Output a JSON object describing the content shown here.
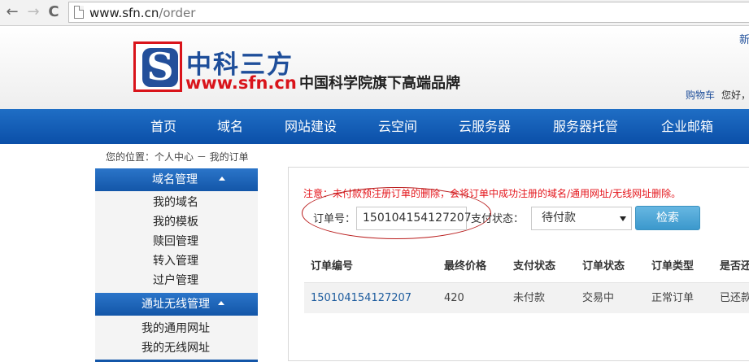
{
  "browser": {
    "back_glyph": "←",
    "forward_glyph": "→",
    "reload_glyph": "C",
    "url_host": "www.sfn.cn",
    "url_path": "/order"
  },
  "header": {
    "logo_letter": "S",
    "brand_cn": "中科三方",
    "brand_url": "www.sfn.cn",
    "slogan": "中国科学院旗下高端品牌",
    "top_right": "新",
    "cart": "购物车",
    "hello": "您好，"
  },
  "nav": {
    "items": [
      "首页",
      "域名",
      "网站建设",
      "云空间",
      "云服务器",
      "服务器托管",
      "企业邮箱"
    ]
  },
  "breadcrumb": "您的位置：个人中心 － 我的订单",
  "sidebar": {
    "sections": [
      {
        "title": "域名管理",
        "links": [
          "我的域名",
          "我的模板",
          "赎回管理",
          "转入管理",
          "过户管理"
        ]
      },
      {
        "title": "通址无线管理",
        "links": [
          "我的通用网址",
          "我的无线网址"
        ]
      }
    ]
  },
  "content": {
    "notice": "注意：未付款预注册订单的删除，会将订单中成功注册的域名/通用网址/无线网址删除。",
    "order_label": "订单号：",
    "order_value": "150104154127207",
    "pay_label": "支付状态：",
    "pay_selected": "待付款",
    "search_label": "检索",
    "table": {
      "headers": [
        "订单编号",
        "最终价格",
        "支付状态",
        "订单状态",
        "订单类型",
        "是否还"
      ],
      "rows": [
        [
          "150104154127207",
          "420",
          "未付款",
          "交易中",
          "正常订单",
          "已还款"
        ]
      ]
    }
  },
  "colors": {
    "accent_blue": "#1e4e9a",
    "nav_blue": "#0b4fa8",
    "notice_red": "#e4151b",
    "button_blue": "#3b98cc"
  }
}
